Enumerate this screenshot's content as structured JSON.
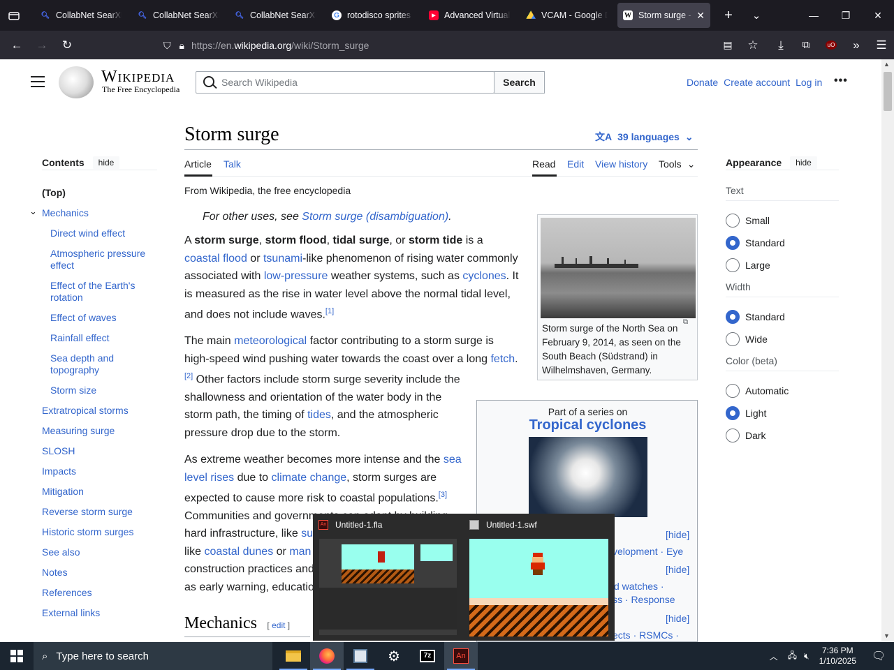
{
  "browser": {
    "tabs": [
      {
        "title": "CollabNet SearXNG",
        "icon": "searxng-icon",
        "active": false
      },
      {
        "title": "CollabNet SearXNG",
        "icon": "searxng-icon",
        "active": false
      },
      {
        "title": "CollabNet SearXNG",
        "icon": "searxng-icon",
        "active": false
      },
      {
        "title": "rotodisco sprites s",
        "icon": "google-icon",
        "active": false
      },
      {
        "title": "Advanced Virtual C",
        "icon": "youtube-icon",
        "active": false
      },
      {
        "title": "VCAM - Google Dr",
        "icon": "google-drive-icon",
        "active": false
      },
      {
        "title": "Storm surge - W",
        "icon": "wikipedia-icon",
        "active": true
      }
    ],
    "url_prefix": "https://en.",
    "url_domain": "wikipedia.org",
    "url_path": "/wiki/Storm_surge"
  },
  "wiki": {
    "wordmark": "Wikipedia",
    "tagline": "The Free Encyclopedia",
    "search_placeholder": "Search Wikipedia",
    "search_button": "Search",
    "donate": "Donate",
    "create_account": "Create account",
    "login": "Log in"
  },
  "toc": {
    "heading": "Contents",
    "hide": "hide",
    "items": [
      {
        "label": "(Top)",
        "level": 0
      },
      {
        "label": "Mechanics",
        "level": 0
      },
      {
        "label": "Direct wind effect",
        "level": 1
      },
      {
        "label": "Atmospheric pressure effect",
        "level": 1
      },
      {
        "label": "Effect of the Earth's rotation",
        "level": 1
      },
      {
        "label": "Effect of waves",
        "level": 1
      },
      {
        "label": "Rainfall effect",
        "level": 1
      },
      {
        "label": "Sea depth and topography",
        "level": 1
      },
      {
        "label": "Storm size",
        "level": 1
      },
      {
        "label": "Extratropical storms",
        "level": 0
      },
      {
        "label": "Measuring surge",
        "level": 0
      },
      {
        "label": "SLOSH",
        "level": 0
      },
      {
        "label": "Impacts",
        "level": 0
      },
      {
        "label": "Mitigation",
        "level": 0
      },
      {
        "label": "Reverse storm surge",
        "level": 0
      },
      {
        "label": "Historic storm surges",
        "level": 0
      },
      {
        "label": "See also",
        "level": 0
      },
      {
        "label": "Notes",
        "level": 0
      },
      {
        "label": "References",
        "level": 0
      },
      {
        "label": "External links",
        "level": 0
      }
    ]
  },
  "article": {
    "title": "Storm surge",
    "languages": "39 languages",
    "tab_article": "Article",
    "tab_talk": "Talk",
    "tab_read": "Read",
    "tab_edit": "Edit",
    "tab_history": "View history",
    "tab_tools": "Tools",
    "from": "From Wikipedia, the free encyclopedia",
    "hatnote_pre": "For other uses, see ",
    "hatnote_link": "Storm surge (disambiguation)",
    "hatnote_post": ".",
    "section_mechanics": "Mechanics",
    "section_edit": "edit",
    "p3_line1_pre": "As extreme weather becomes more intense and the ",
    "p3_line1_link": "sea",
    "p3_line2_link": "level rises",
    "p3_line2_mid": " due to ",
    "p3_line2_link2": "climate change",
    "p3_line2_post": ", storm surges are",
    "p3_line3": "expected to cause more risk to coastal populations.",
    "p3_ref": "[3]",
    "p3_line4": "Communities and governments can adapt by building",
    "p3_line5_pre": "hard infrastructure, like ",
    "p3_line5_link": "su",
    "p3_line6_pre": "like ",
    "p3_line6_link": "coastal dunes",
    "p3_line6_mid": " or ",
    "p3_line6_link2": "man",
    "p3_line7": "construction practices and",
    "p3_line8": "as early warning, educatio"
  },
  "figure": {
    "caption": "Storm surge of the North Sea on February 9, 2014, as seen on the South Beach (Südstrand) in Wilhelmshaven, Germany."
  },
  "series": {
    "pre": "Part of a series on",
    "title": "Tropical cyclones",
    "hide1": "[hide]",
    "row1": "velopment · Eye",
    "hide2": "[hide]",
    "row2a": "d watches ·",
    "row2b": "ss · Response",
    "hide3": "[hide]",
    "row3": "ects · RSMCs ·"
  },
  "appearance": {
    "heading": "Appearance",
    "hide": "hide",
    "text_label": "Text",
    "text_options": [
      "Small",
      "Standard",
      "Large"
    ],
    "text_selected": "Standard",
    "width_label": "Width",
    "width_options": [
      "Standard",
      "Wide"
    ],
    "width_selected": "Standard",
    "color_label": "Color (beta)",
    "color_options": [
      "Automatic",
      "Light",
      "Dark"
    ],
    "color_selected": "Light"
  },
  "popup": {
    "window1": "Untitled-1.fla",
    "window2": "Untitled-1.swf"
  },
  "taskbar": {
    "search_placeholder": "Type here to search",
    "time": "7:36 PM",
    "date": "1/10/2025"
  },
  "colors": {
    "link": "#3366cc",
    "accent": "#3366cc",
    "tabbar": "#1c1b22",
    "navbar": "#2b2a33"
  }
}
